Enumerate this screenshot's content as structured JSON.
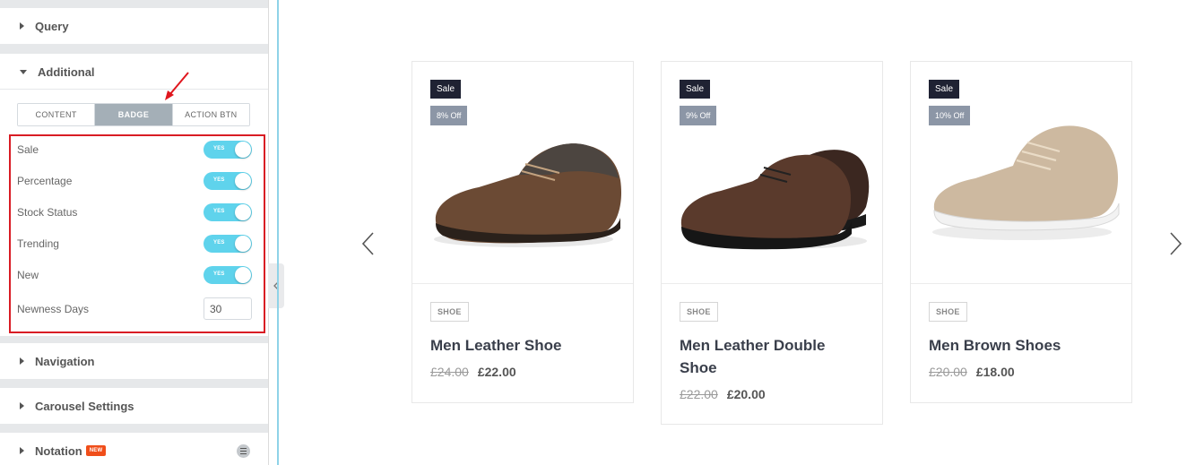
{
  "panel": {
    "sections": {
      "query": "Query",
      "additional": "Additional",
      "navigation": "Navigation",
      "carousel_settings": "Carousel Settings",
      "notation": "Notation",
      "notation_badge": "NEW"
    },
    "tabs": [
      "CONTENT",
      "BADGE",
      "ACTION BTN"
    ],
    "active_tab": "BADGE",
    "toggle_on_text": "YES",
    "controls": [
      {
        "label": "Sale",
        "state": "YES"
      },
      {
        "label": "Percentage",
        "state": "YES"
      },
      {
        "label": "Stock Status",
        "state": "YES"
      },
      {
        "label": "Trending",
        "state": "YES"
      },
      {
        "label": "New",
        "state": "YES"
      }
    ],
    "newness": {
      "label": "Newness Days",
      "value": "30"
    }
  },
  "colors": {
    "toggle_on": "#5fd3ec",
    "highlight": "#d91c24",
    "sale_badge": "#1f2233",
    "off_badge": "#8c96a6",
    "new_tag": "#f04e1a"
  },
  "icons": {
    "collapse": "chevron-left-icon",
    "prev": "chevron-left-icon",
    "next": "chevron-right-icon"
  },
  "products": [
    {
      "sale": "Sale",
      "off": "8% Off",
      "category": "SHOE",
      "title": "Men Leather Shoe",
      "price_old": "£24.00",
      "price_new": "£22.00"
    },
    {
      "sale": "Sale",
      "off": "9% Off",
      "category": "SHOE",
      "title": "Men Leather Double Shoe",
      "price_old": "£22.00",
      "price_new": "£20.00"
    },
    {
      "sale": "Sale",
      "off": "10% Off",
      "category": "SHOE",
      "title": "Men Brown Shoes",
      "price_old": "£20.00",
      "price_new": "£18.00"
    }
  ]
}
